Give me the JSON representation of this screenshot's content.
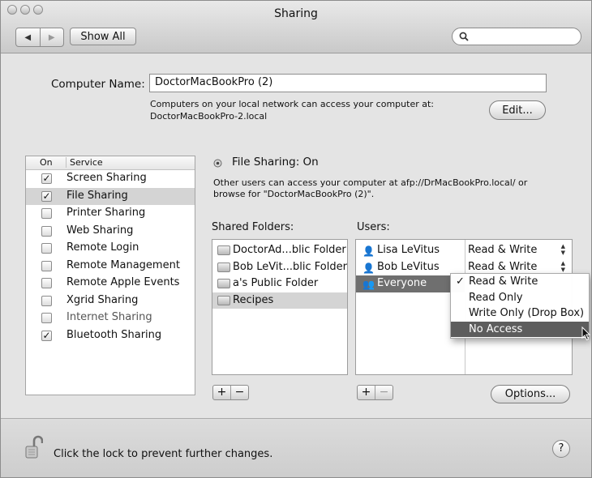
{
  "window": {
    "title": "Sharing",
    "back_glyph": "◀",
    "forward_glyph": "▶",
    "show_all_label": "Show All",
    "search_value": "",
    "search_icon": "magnifier-icon"
  },
  "computer": {
    "name_label": "Computer Name:",
    "name_value": "DoctorMacBookPro (2)",
    "info_line1": "Computers on your local network can access your computer at:",
    "info_line2": "DoctorMacBookPro-2.local",
    "edit_label": "Edit..."
  },
  "services": {
    "header_on": "On",
    "header_service": "Service",
    "items": [
      {
        "label": "Screen Sharing",
        "checked": "✓"
      },
      {
        "label": "File Sharing",
        "checked": "✓"
      },
      {
        "label": "Printer Sharing",
        "checked": ""
      },
      {
        "label": "Web Sharing",
        "checked": ""
      },
      {
        "label": "Remote Login",
        "checked": ""
      },
      {
        "label": "Remote Management",
        "checked": ""
      },
      {
        "label": "Remote Apple Events",
        "checked": ""
      },
      {
        "label": "Xgrid Sharing",
        "checked": ""
      },
      {
        "label": "Internet Sharing",
        "checked": ""
      },
      {
        "label": "Bluetooth Sharing",
        "checked": "✓"
      }
    ]
  },
  "status": {
    "text": "File Sharing: On",
    "desc_line1": "Other users can access your computer at afp://DrMacBookPro.local/ or",
    "desc_line2": "browse for \"DoctorMacBookPro (2)\"."
  },
  "shared_folders": {
    "label": "Shared Folders:",
    "items": [
      "DoctorAd...blic Folder",
      "Bob LeVit...blic Folder",
      "a's Public Folder",
      "Recipes"
    ]
  },
  "users": {
    "label": "Users:",
    "items": [
      {
        "name": "Lisa LeVitus",
        "permission": "Read & Write"
      },
      {
        "name": "Bob LeVitus",
        "permission": "Read & Write"
      },
      {
        "name": "Everyone",
        "permission": "Read & Write"
      }
    ]
  },
  "permission_menu": {
    "items": [
      {
        "label": "Read & Write",
        "check": "✓"
      },
      {
        "label": "Read Only",
        "check": ""
      },
      {
        "label": "Write Only (Drop Box)",
        "check": ""
      },
      {
        "label": "No Access",
        "check": ""
      }
    ]
  },
  "buttons": {
    "plus": "+",
    "minus": "−",
    "options_label": "Options..."
  },
  "footer": {
    "lock_text": "Click the lock to prevent further changes.",
    "help": "?"
  },
  "colors": {
    "window_bg": "#e4e4e4",
    "selection": "#6f6f6f",
    "menu_highlight": "#5d5d5d"
  }
}
